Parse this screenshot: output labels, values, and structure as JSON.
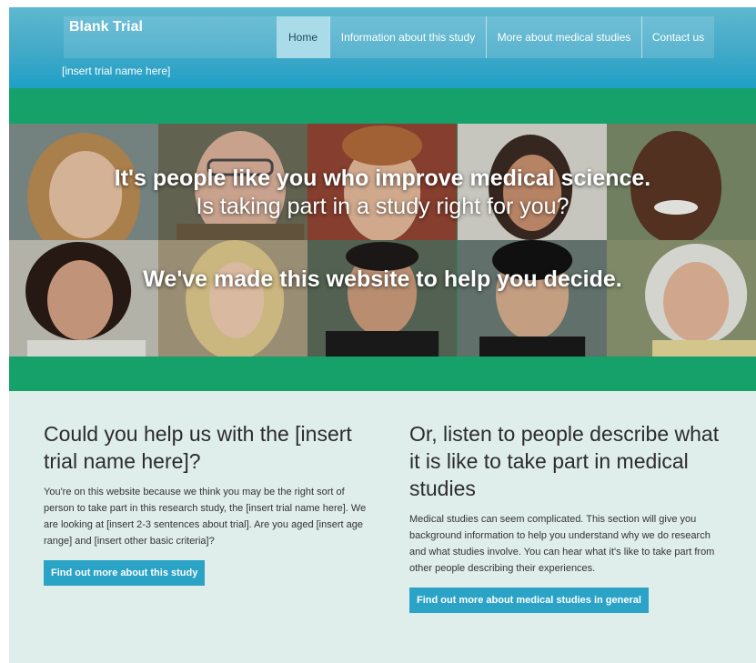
{
  "header": {
    "title": "Blank Trial",
    "subtitle": "[insert trial name here]",
    "nav": [
      {
        "label": "Home",
        "active": true
      },
      {
        "label": "Information about this study",
        "active": false
      },
      {
        "label": "More about medical studies",
        "active": false
      },
      {
        "label": "Contact us",
        "active": false
      }
    ]
  },
  "hero": {
    "line1": "It's people like you who improve medical science.",
    "line2": "Is taking part in a study right for you?",
    "line3": "We've made this website to help you decide."
  },
  "left": {
    "heading": "Could you help us with the [insert trial name here]?",
    "body": "You're on this website because we think you may be the right sort of person to take part in this research study, the [insert trial name here]. We are looking at [insert 2-3 sentences about trial].  Are you aged [insert age range] and [insert other basic criteria]?",
    "button": "Find out more about this study"
  },
  "right": {
    "heading": "Or, listen to people describe what it is like to take part in medical studies",
    "body": "Medical studies can seem complicated. This section will give you background information to help you understand why we do research and what studies involve. You can hear what it's like to take part from other people describing their experiences.",
    "button": "Find out more about medical studies in general"
  },
  "colors": {
    "header": "#42a9c8",
    "green": "#16a06a",
    "button": "#2aa3c6",
    "content_bg": "#dfeeea"
  }
}
